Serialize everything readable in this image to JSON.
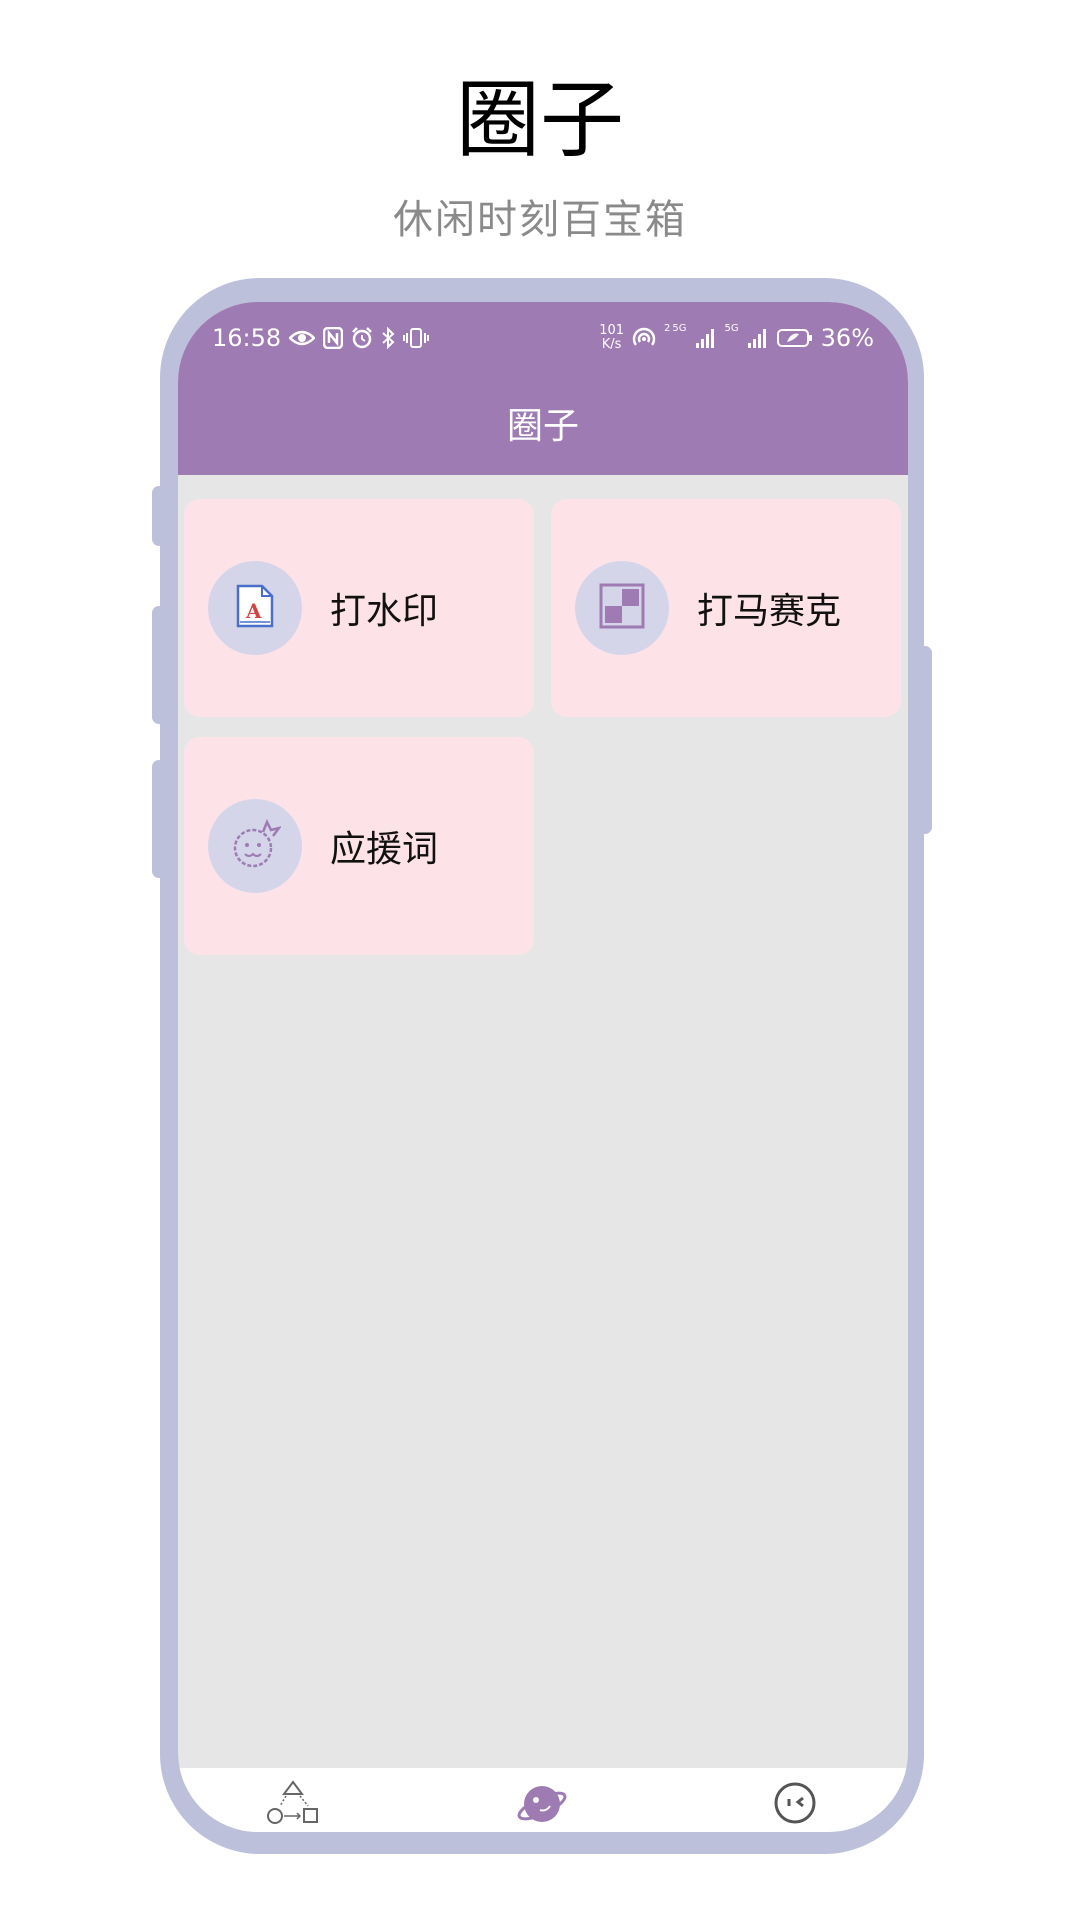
{
  "promo": {
    "title": "圈子",
    "subtitle": "休闲时刻百宝箱"
  },
  "status_bar": {
    "time": "16:58",
    "net_speed_value": "101",
    "net_speed_unit": "K/s",
    "network_labels": [
      "2",
      "5G",
      "5G"
    ],
    "battery_percent": "36%",
    "icons_left": [
      "eye-icon",
      "nfc-icon",
      "alarm-icon",
      "bluetooth-icon",
      "vibrate-icon"
    ],
    "icons_right": [
      "hotspot-icon",
      "signal-icon",
      "signal-icon",
      "battery-icon"
    ]
  },
  "appbar": {
    "title": "圈子"
  },
  "cards": [
    {
      "label": "打水印",
      "icon": "watermark-document-icon"
    },
    {
      "label": "打马赛克",
      "icon": "mosaic-icon"
    },
    {
      "label": "应援词",
      "icon": "cheer-face-icon"
    }
  ],
  "bottom_nav": {
    "items": [
      {
        "icon": "shapes-icon",
        "active": false
      },
      {
        "icon": "planet-icon",
        "active": true
      },
      {
        "icon": "face-icon",
        "active": false
      }
    ]
  },
  "colors": {
    "appbar": "#9e7bb2",
    "card": "#fde3e8",
    "icon_circle": "#d5d5ea",
    "phone_frame": "#bcc0da",
    "screen_bg": "#e6e6e6",
    "accent": "#9e7bb2"
  }
}
